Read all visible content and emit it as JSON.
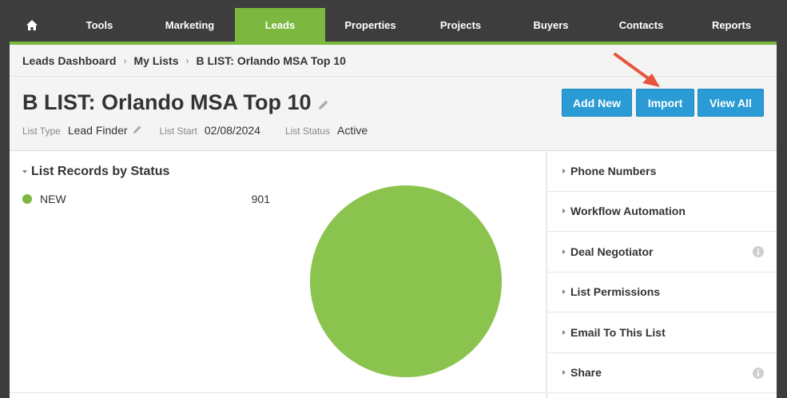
{
  "nav": {
    "items": [
      {
        "label": "",
        "icon": "home-icon"
      },
      {
        "label": "Tools"
      },
      {
        "label": "Marketing"
      },
      {
        "label": "Leads",
        "active": true
      },
      {
        "label": "Properties"
      },
      {
        "label": "Projects"
      },
      {
        "label": "Buyers"
      },
      {
        "label": "Contacts"
      },
      {
        "label": "Reports"
      }
    ]
  },
  "breadcrumb": {
    "items": [
      "Leads Dashboard",
      "My Lists",
      "B LIST: Orlando MSA Top 10"
    ],
    "separator": "›"
  },
  "header": {
    "title": "B LIST: Orlando MSA Top 10",
    "list_type_label": "List Type",
    "list_type_value": "Lead Finder",
    "list_start_label": "List Start",
    "list_start_value": "02/08/2024",
    "list_status_label": "List Status",
    "list_status_value": "Active"
  },
  "actions": {
    "add_new": "Add New",
    "import": "Import",
    "view_all": "View All"
  },
  "records": {
    "title": "List Records by Status",
    "legend": [
      {
        "name": "NEW",
        "count": "901",
        "color": "#8bc34f"
      }
    ]
  },
  "chart_data": {
    "type": "pie",
    "categories": [
      "NEW"
    ],
    "values": [
      901
    ],
    "colors": [
      "#8bc34f"
    ],
    "title": "List Records by Status"
  },
  "sidebar": {
    "items": [
      {
        "label": "Phone Numbers",
        "info": false
      },
      {
        "label": "Workflow Automation",
        "info": false
      },
      {
        "label": "Deal Negotiator",
        "info": true
      },
      {
        "label": "List Permissions",
        "info": false
      },
      {
        "label": "Email To This List",
        "info": false
      },
      {
        "label": "Share",
        "info": true
      }
    ]
  },
  "colors": {
    "nav_bg": "#3d3d3d",
    "accent_green": "#7cb83f",
    "button_blue": "#2a9bd5",
    "arrow_red": "#e8553e"
  }
}
